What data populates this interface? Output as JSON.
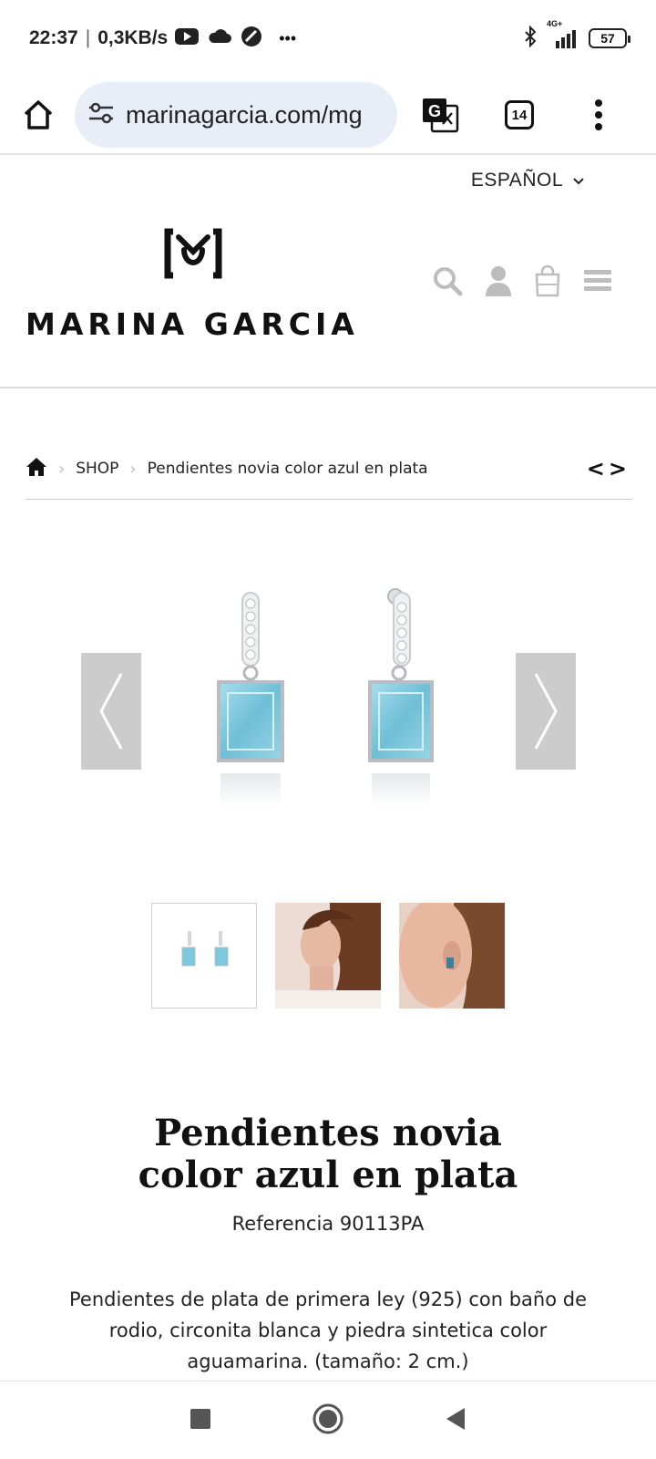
{
  "status_bar": {
    "time": "22:37",
    "network_speed": "0,3KB/s",
    "overflow": "•••",
    "network_type": "4G+",
    "battery": "57"
  },
  "browser": {
    "url": "marinagarcia.com/mg",
    "tab_count": "14",
    "icons": [
      "home-icon",
      "site-settings-icon",
      "translate-icon",
      "tabs-icon",
      "menu-kebab-icon"
    ]
  },
  "site": {
    "language": "ESPAÑOL",
    "brand": "MARINA GARCIA",
    "logo_letter": "M",
    "header_icons": [
      "search-icon",
      "user-icon",
      "bag-icon",
      "hamburger-icon"
    ]
  },
  "breadcrumb": {
    "items": [
      "SHOP",
      "Pendientes novia color azul en plata"
    ],
    "arrows": "<>"
  },
  "product": {
    "title": "Pendientes novia color azul en plata",
    "reference": "Referencia 90113PA",
    "description": "Pendientes de plata de primera ley (925) con baño de rodio, circonita blanca y piedra sintetica color aguamarina. (tamaño: 2 cm.)",
    "thumbnails": [
      "earrings-product-thumb",
      "model-profile-thumb",
      "model-closeup-thumb"
    ],
    "colors": {
      "stone": "#7cc8dc",
      "silver": "#c9cdd2"
    }
  },
  "android_nav": [
    "recents-icon",
    "home-circle-icon",
    "back-icon"
  ]
}
